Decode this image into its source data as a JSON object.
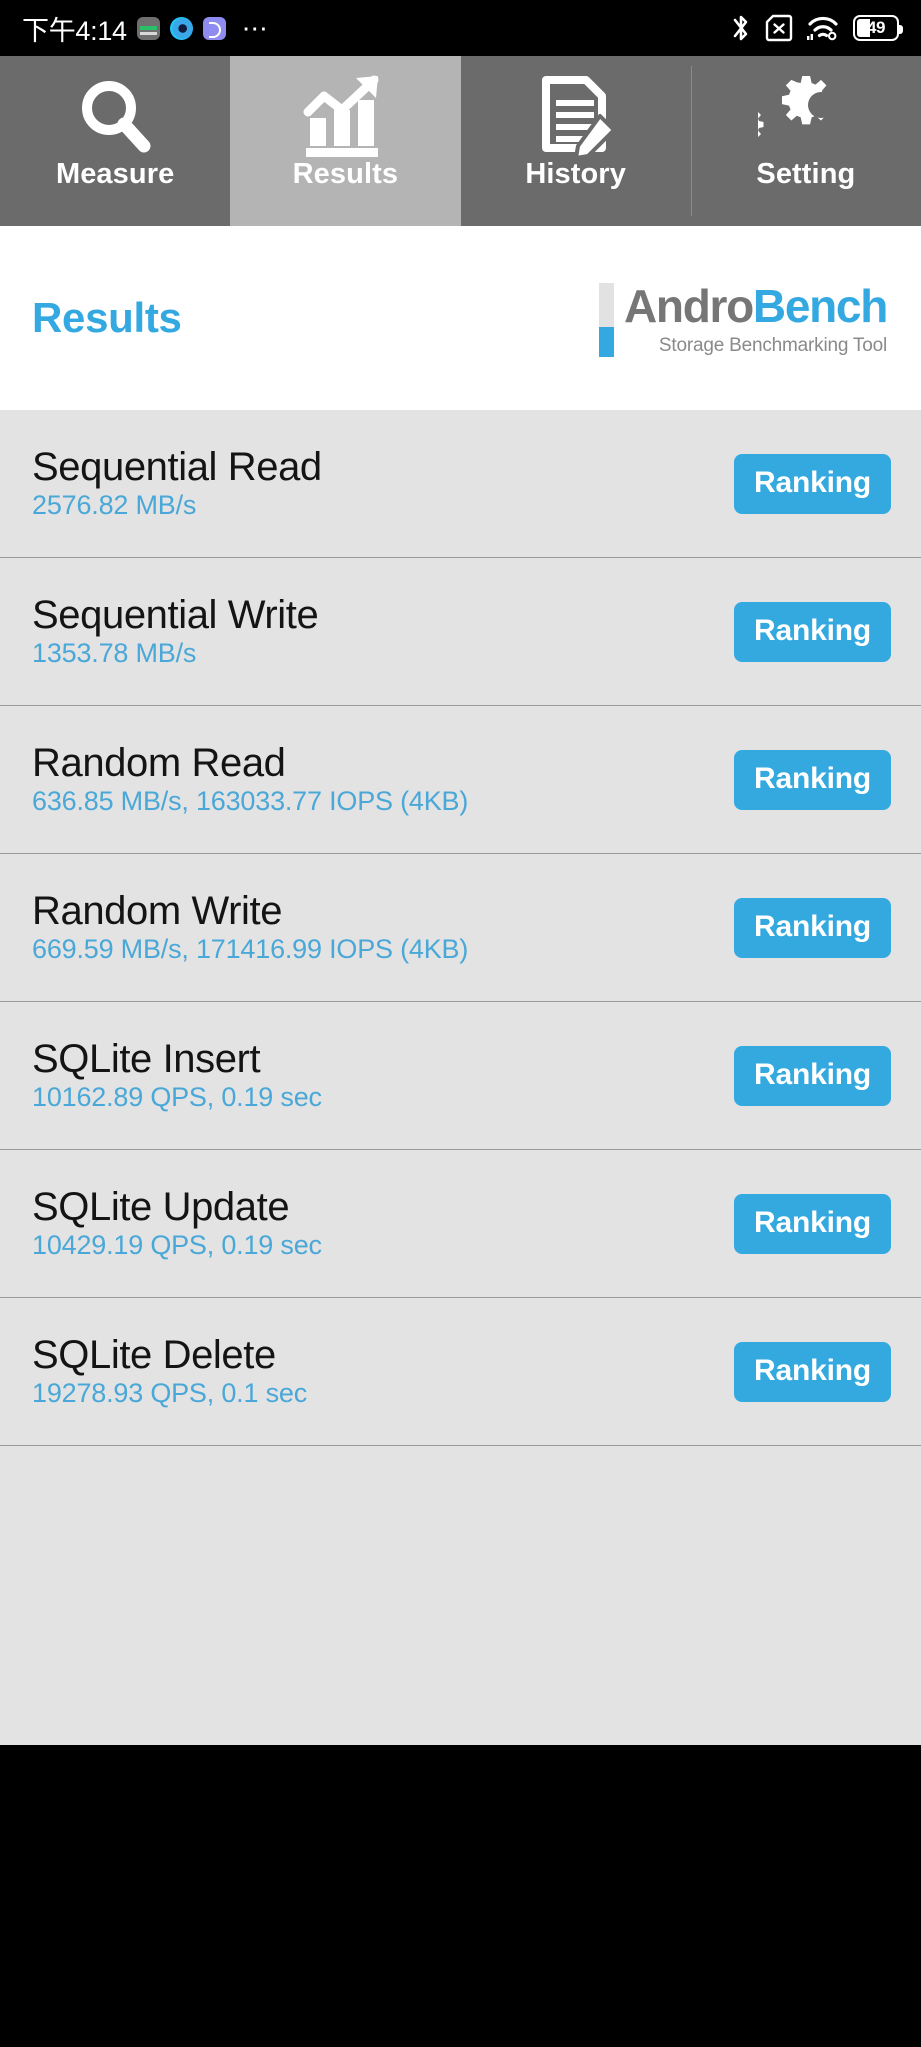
{
  "statusbar": {
    "clock": "下午4:14",
    "overflow": "⋯",
    "left_icons": [
      "notes-app-icon",
      "eye-app-icon",
      "zenly-app-icon"
    ],
    "right_icons": [
      "bluetooth-icon",
      "no-sim-icon",
      "wifi-icon"
    ],
    "battery_level": "49"
  },
  "tabs": [
    {
      "label": "Measure",
      "icon": "magnifier-icon",
      "active": false
    },
    {
      "label": "Results",
      "icon": "bar-chart-arrow-icon",
      "active": true
    },
    {
      "label": "History",
      "icon": "document-pencil-icon",
      "active": false
    },
    {
      "label": "Setting",
      "icon": "gears-icon",
      "active": false
    }
  ],
  "header": {
    "page_title": "Results",
    "logo_word_1": "Andro",
    "logo_word_2": "Bench",
    "logo_subtitle": "Storage Benchmarking Tool"
  },
  "results": {
    "ranking_label": "Ranking",
    "rows": [
      {
        "title": "Sequential Read",
        "value": "2576.82 MB/s"
      },
      {
        "title": "Sequential Write",
        "value": "1353.78 MB/s"
      },
      {
        "title": "Random Read",
        "value": "636.85 MB/s, 163033.77 IOPS (4KB)"
      },
      {
        "title": "Random Write",
        "value": "669.59 MB/s, 171416.99 IOPS (4KB)"
      },
      {
        "title": "SQLite Insert",
        "value": "10162.89 QPS, 0.19 sec"
      },
      {
        "title": "SQLite Update",
        "value": "10429.19 QPS, 0.19 sec"
      },
      {
        "title": "SQLite Delete",
        "value": "19278.93 QPS, 0.1 sec"
      }
    ]
  },
  "colors": {
    "accent_blue": "#34a8e0",
    "value_blue": "#4aa8d8",
    "tab_inactive": "#6b6b6b",
    "tab_active": "#b4b4b4",
    "list_bg": "#e3e3e3"
  }
}
